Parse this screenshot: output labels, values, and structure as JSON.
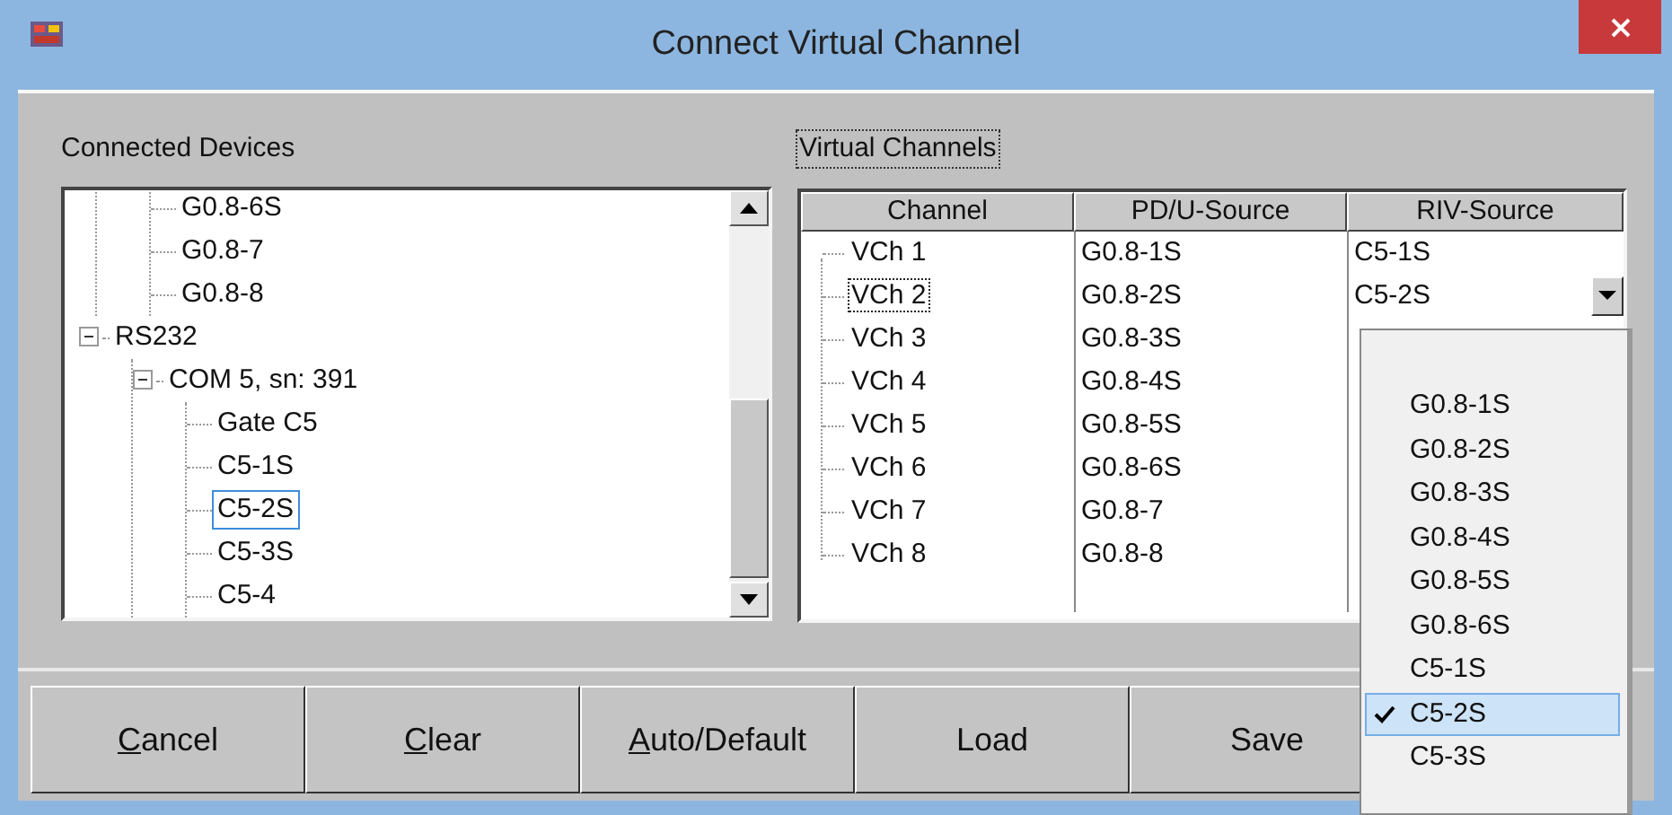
{
  "window": {
    "title": "Connect Virtual Channel"
  },
  "connected_devices": {
    "label": "Connected Devices",
    "tree": [
      {
        "children": [
          {
            "children": [
              {
                "label": "G0.8-6S",
                "selected": false
              },
              {
                "label": "G0.8-7",
                "selected": false
              },
              {
                "label": "G0.8-8",
                "selected": false
              }
            ]
          }
        ]
      },
      {
        "label": "RS232",
        "expanded": true,
        "selected": false,
        "children": [
          {
            "label": "COM 5, sn: 391",
            "expanded": true,
            "selected": false,
            "children": [
              {
                "label": "Gate  C5",
                "selected": false
              },
              {
                "label": "C5-1S",
                "selected": false
              },
              {
                "label": "C5-2S",
                "selected": true
              },
              {
                "label": "C5-3S",
                "selected": false
              },
              {
                "label": "C5-4",
                "selected": false
              }
            ]
          }
        ]
      }
    ]
  },
  "virtual_channels": {
    "label": "Virtual Channels",
    "columns": [
      "Channel",
      "PD/U-Source",
      "RIV-Source"
    ],
    "rows": [
      {
        "channel": "VCh 1",
        "pd_u_source": "G0.8-1S",
        "riv_source": "C5-1S",
        "selected": false
      },
      {
        "channel": "VCh 2",
        "pd_u_source": "G0.8-2S",
        "riv_source": "C5-2S",
        "selected": true
      },
      {
        "channel": "VCh 3",
        "pd_u_source": "G0.8-3S",
        "selected": false
      },
      {
        "channel": "VCh 4",
        "pd_u_source": "G0.8-4S",
        "selected": false
      },
      {
        "channel": "VCh 5",
        "pd_u_source": "G0.8-5S",
        "selected": false
      },
      {
        "channel": "VCh 6",
        "pd_u_source": "G0.8-6S",
        "selected": false
      },
      {
        "channel": "VCh 7",
        "pd_u_source": "G0.8-7",
        "selected": false
      },
      {
        "channel": "VCh 8",
        "pd_u_source": "G0.8-8",
        "selected": false
      }
    ],
    "dropdown_options": [
      {
        "label": "G0.8-1S",
        "selected": false
      },
      {
        "label": "G0.8-2S",
        "selected": false
      },
      {
        "label": "G0.8-3S",
        "selected": false
      },
      {
        "label": "G0.8-4S",
        "selected": false
      },
      {
        "label": "G0.8-5S",
        "selected": false
      },
      {
        "label": "G0.8-6S",
        "selected": false
      },
      {
        "label": "C5-1S",
        "selected": false
      },
      {
        "label": "C5-2S",
        "selected": true
      },
      {
        "label": "C5-3S",
        "selected": false
      }
    ]
  },
  "buttons": [
    {
      "label": "Cancel",
      "mnemonic": true
    },
    {
      "label": "Clear",
      "mnemonic": true
    },
    {
      "label": "Auto/Default",
      "mnemonic": true
    },
    {
      "label": "Load",
      "mnemonic": false
    },
    {
      "label": "Save",
      "mnemonic": false
    }
  ]
}
